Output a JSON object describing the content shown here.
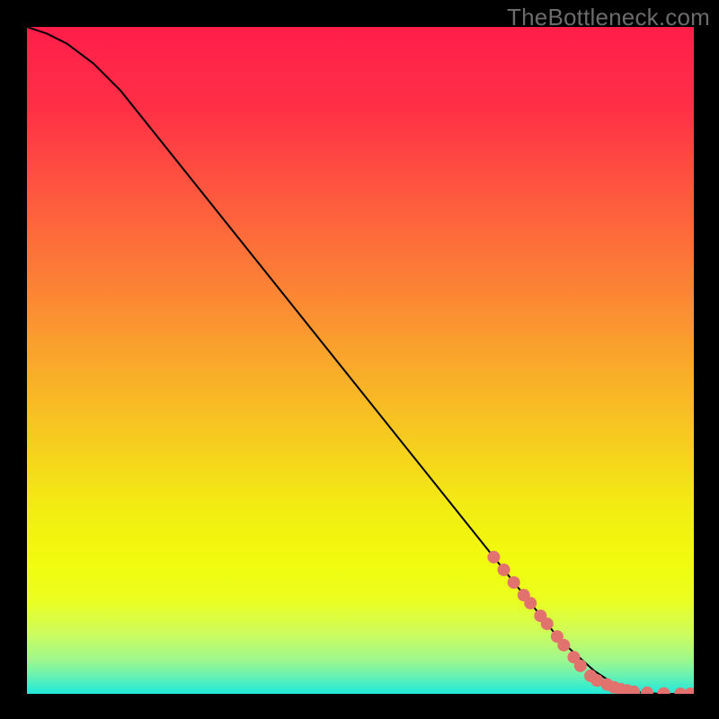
{
  "watermark": "TheBottleneck.com",
  "chart_data": {
    "type": "line",
    "title": "",
    "xlabel": "",
    "ylabel": "",
    "xlim": [
      0,
      100
    ],
    "ylim": [
      0,
      100
    ],
    "grid": false,
    "series": [
      {
        "name": "curve",
        "style": "line",
        "color": "#000000",
        "x": [
          0,
          3,
          6,
          10,
          14,
          20,
          30,
          40,
          50,
          60,
          70,
          80,
          85,
          88,
          90,
          92,
          95,
          100
        ],
        "y": [
          100,
          99,
          97.5,
          94.5,
          90.5,
          83,
          70.5,
          58,
          45.5,
          33,
          20.5,
          8,
          3.5,
          1.5,
          0.6,
          0.2,
          0,
          0
        ]
      },
      {
        "name": "markers",
        "style": "scatter",
        "color": "#E2726E",
        "x": [
          70,
          71.5,
          73,
          74.5,
          75.5,
          77,
          78,
          79.5,
          80.5,
          82,
          83,
          84.5,
          85.5,
          87,
          88,
          89,
          90,
          91,
          93,
          95.5,
          98,
          99.5
        ],
        "y": [
          20.5,
          18.6,
          16.7,
          14.8,
          13.6,
          11.7,
          10.5,
          8.6,
          7.3,
          5.5,
          4.2,
          2.7,
          2.0,
          1.4,
          1.0,
          0.7,
          0.5,
          0.3,
          0.15,
          0.05,
          0.0,
          0.0
        ]
      }
    ],
    "background_gradient": {
      "stops": [
        {
          "pos": 0.0,
          "color": "#FF1E4A"
        },
        {
          "pos": 0.12,
          "color": "#FF2F46"
        },
        {
          "pos": 0.25,
          "color": "#FE583F"
        },
        {
          "pos": 0.38,
          "color": "#FC7F36"
        },
        {
          "pos": 0.5,
          "color": "#F9A72B"
        },
        {
          "pos": 0.62,
          "color": "#F6CC1F"
        },
        {
          "pos": 0.72,
          "color": "#F3EC13"
        },
        {
          "pos": 0.8,
          "color": "#F1FB0D"
        },
        {
          "pos": 0.86,
          "color": "#EAFE20"
        },
        {
          "pos": 0.91,
          "color": "#CEFC5D"
        },
        {
          "pos": 0.95,
          "color": "#9DF78F"
        },
        {
          "pos": 0.975,
          "color": "#64F1B5"
        },
        {
          "pos": 0.99,
          "color": "#39ECCD"
        },
        {
          "pos": 1.0,
          "color": "#22E9D8"
        }
      ]
    }
  }
}
